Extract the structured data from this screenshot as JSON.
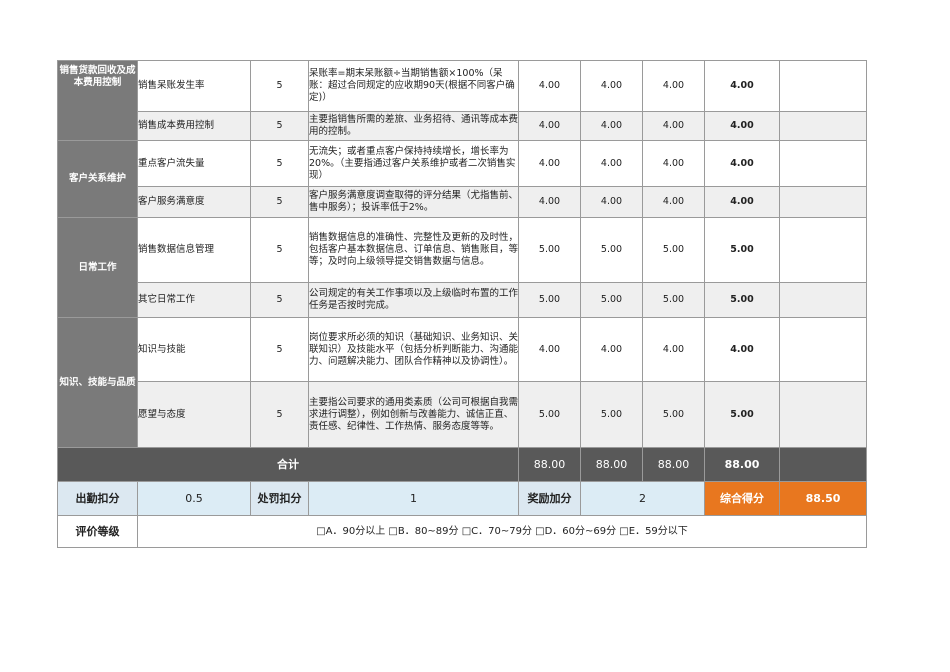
{
  "sections": [
    {
      "category": "销售货款回收及成本费用控制",
      "rows": [
        {
          "item": "销售呆账发生率",
          "weight": "5",
          "desc": "呆账率=期末呆账额÷当期销售额×100%（呆账：超过合同规定的应收期90天(根据不同客户确定)）",
          "s1": "4.00",
          "s2": "4.00",
          "s3": "4.00",
          "total": "4.00"
        },
        {
          "item": "销售成本费用控制",
          "weight": "5",
          "desc": "主要指销售所需的差旅、业务招待、通讯等成本费用的控制。",
          "s1": "4.00",
          "s2": "4.00",
          "s3": "4.00",
          "total": "4.00"
        }
      ]
    },
    {
      "category": "客户关系维护",
      "rows": [
        {
          "item": "重点客户流失量",
          "weight": "5",
          "desc": "无流失；或者重点客户保持持续增长，增长率为20%。（主要指通过客户关系维护或者二次销售实现）",
          "s1": "4.00",
          "s2": "4.00",
          "s3": "4.00",
          "total": "4.00"
        },
        {
          "item": "客户服务满意度",
          "weight": "5",
          "desc": "客户服务满意度调查取得的评分结果（尤指售前、售中服务）；投诉率低于2%。",
          "s1": "4.00",
          "s2": "4.00",
          "s3": "4.00",
          "total": "4.00"
        }
      ]
    },
    {
      "category": "日常工作",
      "rows": [
        {
          "item": "销售数据信息管理",
          "weight": "5",
          "desc": "销售数据信息的准确性、完整性及更新的及时性，包括客户基本数据信息、订单信息、销售账目，等等；及时向上级领导提交销售数据与信息。",
          "s1": "5.00",
          "s2": "5.00",
          "s3": "5.00",
          "total": "5.00"
        },
        {
          "item": "其它日常工作",
          "weight": "5",
          "desc": "公司规定的有关工作事项以及上级临时布置的工作任务是否按时完成。",
          "s1": "5.00",
          "s2": "5.00",
          "s3": "5.00",
          "total": "5.00"
        }
      ]
    },
    {
      "category": "知识、技能与品质",
      "rows": [
        {
          "item": "知识与技能",
          "weight": "5",
          "desc": "岗位要求所必须的知识（基础知识、业务知识、关联知识）及技能水平（包括分析判断能力、沟通能力、问题解决能力、团队合作精神以及协调性）。",
          "s1": "4.00",
          "s2": "4.00",
          "s3": "4.00",
          "total": "4.00"
        },
        {
          "item": "愿望与态度",
          "weight": "5",
          "desc": "主要指公司要求的通用类素质（公司可根据自我需求进行调整），例如创新与改善能力、诚信正直、责任感、纪律性、工作热情、服务态度等等。",
          "s1": "5.00",
          "s2": "5.00",
          "s3": "5.00",
          "total": "5.00"
        }
      ]
    }
  ],
  "total_row": {
    "label": "合计",
    "s1": "88.00",
    "s2": "88.00",
    "s3": "88.00",
    "total": "88.00"
  },
  "score_row": {
    "attendance_label": "出勤扣分",
    "attendance_value": "0.5",
    "penalty_label": "处罚扣分",
    "penalty_value": "1",
    "bonus_label": "奖励加分",
    "bonus_value": "2",
    "final_label": "综合得分",
    "final_value": "88.50"
  },
  "grade_row": {
    "label": "评价等级",
    "options": "□A．90分以上 □B．80~89分 □C．70~79分 □D．60分~69分 □E．59分以下"
  },
  "colors": {
    "category_bg": "#7a7a7a",
    "total_bg": "#595959",
    "final_bg": "#e8771f",
    "label_bg": "#dce8f1"
  }
}
